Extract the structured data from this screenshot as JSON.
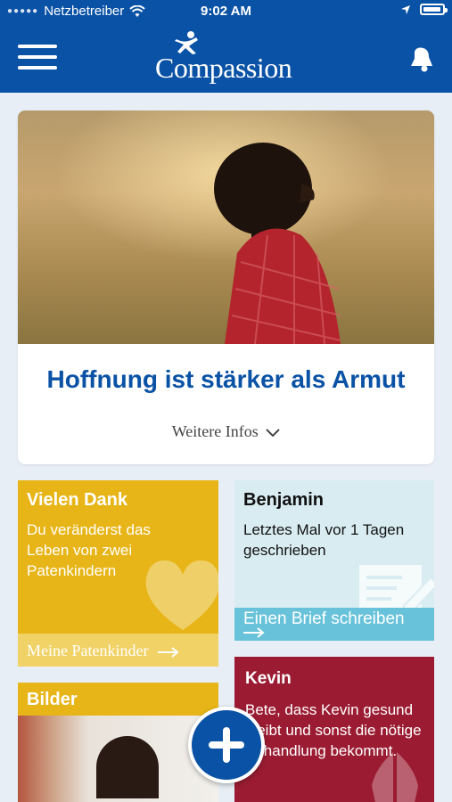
{
  "status_bar": {
    "carrier": "Netzbetreiber",
    "time": "9:02 AM"
  },
  "header": {
    "logo_text": "Compassion",
    "brand_color": "#0a52a5"
  },
  "hero": {
    "title": "Hoffnung ist stärker als Armut",
    "more_label": "Weitere Infos"
  },
  "tiles": {
    "thanks": {
      "title": "Vielen Dank",
      "body": "Du veränderst das Leben von zwei Patenkindern",
      "footer": "Meine Patenkinder",
      "color": "#e7b517"
    },
    "benjamin": {
      "title": "Benjamin",
      "body": "Letztes Mal vor 1 Tagen geschrieben",
      "footer": "Einen Brief schreiben",
      "color": "#67c2da"
    },
    "kevin": {
      "title": "Kevin",
      "body": "Bete, dass Kevin gesund bleibt und sonst die nötige Behandlung bekommt.",
      "color": "#9b1c32"
    },
    "bilder": {
      "title": "Bilder"
    }
  },
  "icons": [
    "menu-icon",
    "bell-icon",
    "wifi-icon",
    "location-icon",
    "battery-icon",
    "chevron-down-icon",
    "arrow-right-icon",
    "heart-icon",
    "letter-icon",
    "praying-hands-icon",
    "plus-icon"
  ]
}
